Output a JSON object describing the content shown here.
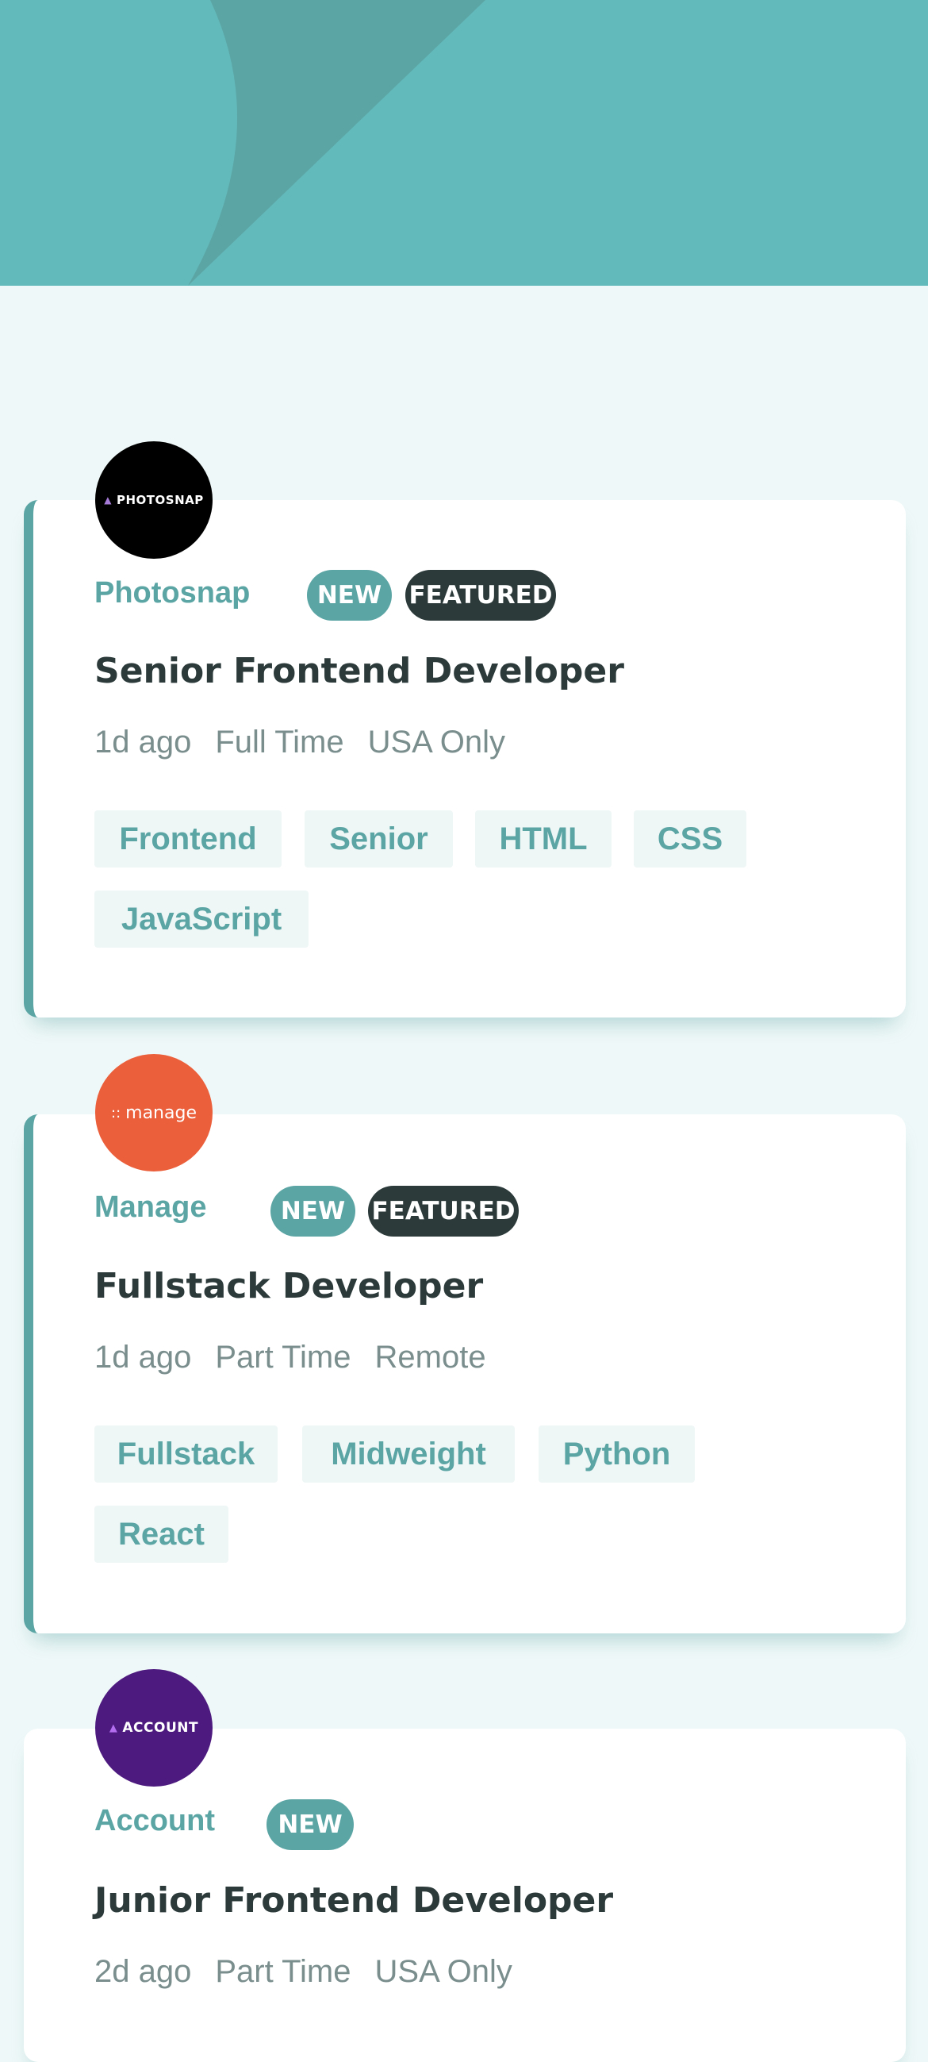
{
  "colors": {
    "primary": "#5ca5a5",
    "header_bg": "#63babb",
    "page_bg": "#eff8f8",
    "dark": "#2c3a3a",
    "muted": "#7b8e8e",
    "tag_bg": "#eff6f6"
  },
  "jobs": [
    {
      "logo_text": "PHOTOSNAP",
      "logo_icon": "photosnap-triangle-icon",
      "company": "Photosnap",
      "new_label": "NEW",
      "featured_label": "FEATURED",
      "position": "Senior Frontend Developer",
      "posted": "1d ago",
      "contract": "Full Time",
      "location": "USA Only",
      "tags": [
        "Frontend",
        "Senior",
        "HTML",
        "CSS",
        "JavaScript"
      ]
    },
    {
      "logo_text": "manage",
      "logo_icon": "manage-dots-icon",
      "company": "Manage",
      "new_label": "NEW",
      "featured_label": "FEATURED",
      "position": "Fullstack Developer",
      "posted": "1d ago",
      "contract": "Part Time",
      "location": "Remote",
      "tags": [
        "Fullstack",
        "Midweight",
        "Python",
        "React"
      ]
    },
    {
      "logo_text": "ACCOUNT",
      "logo_icon": "account-triangle-icon",
      "company": "Account",
      "new_label": "NEW",
      "position": "Junior Frontend Developer",
      "posted": "2d ago",
      "contract": "Part Time",
      "location": "USA Only"
    }
  ]
}
